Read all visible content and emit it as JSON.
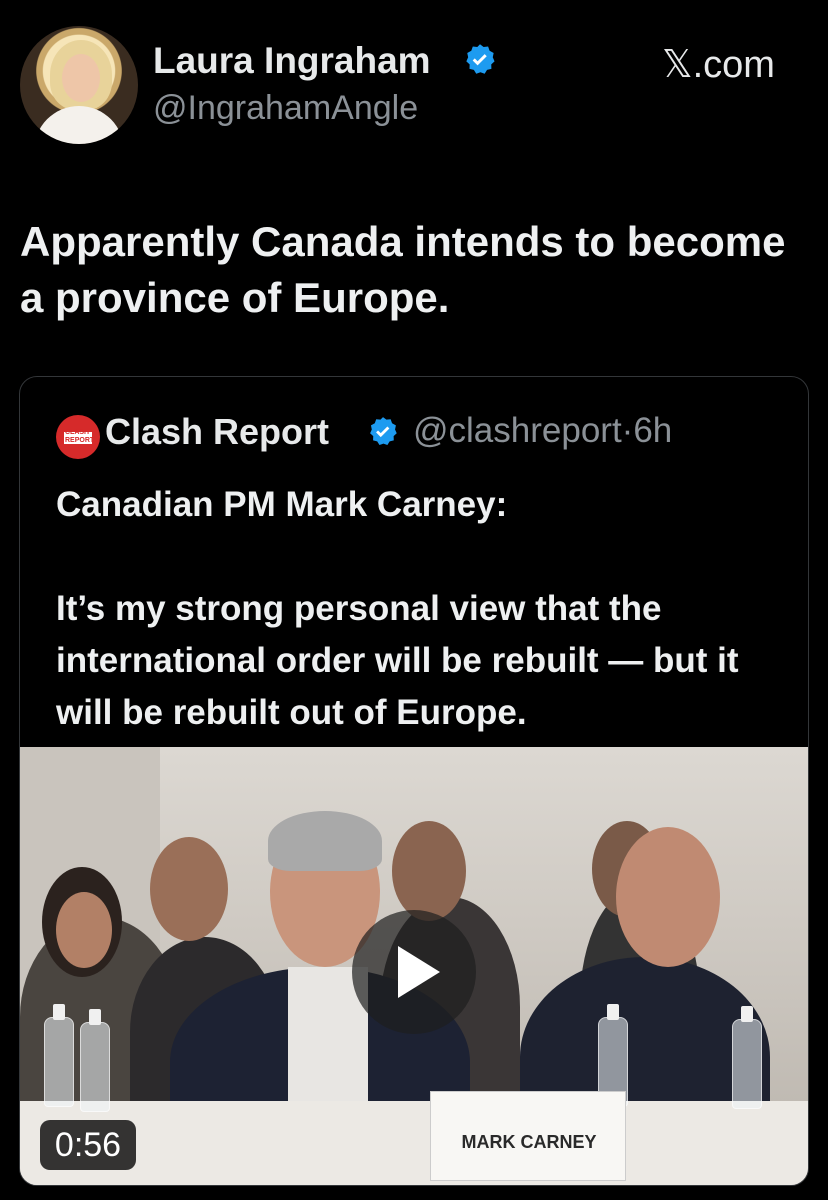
{
  "tweet": {
    "author_name": "Laura Ingraham",
    "author_handle": "@IngrahamAngle",
    "site": "𝕏.com",
    "text": "Apparently Canada intends to become a province of Europe."
  },
  "quoted_tweet": {
    "author_name": "Clash Report",
    "author_handle_time": "@clashreport·6h",
    "avatar_text": "CLASH REPORT",
    "text_lines": [
      "Canadian PM Mark Carney:",
      "It’s my strong personal view that the international order will be rebuilt — but it will be rebuilt out of Europe."
    ],
    "video": {
      "nameplate": "MARK CARNEY",
      "duration": "0:56"
    }
  },
  "colors": {
    "background": "#000000",
    "verified_blue": "#1d9bf0",
    "secondary_text": "#8b9197"
  },
  "icons": [
    "verified-badge-icon",
    "play-icon"
  ]
}
